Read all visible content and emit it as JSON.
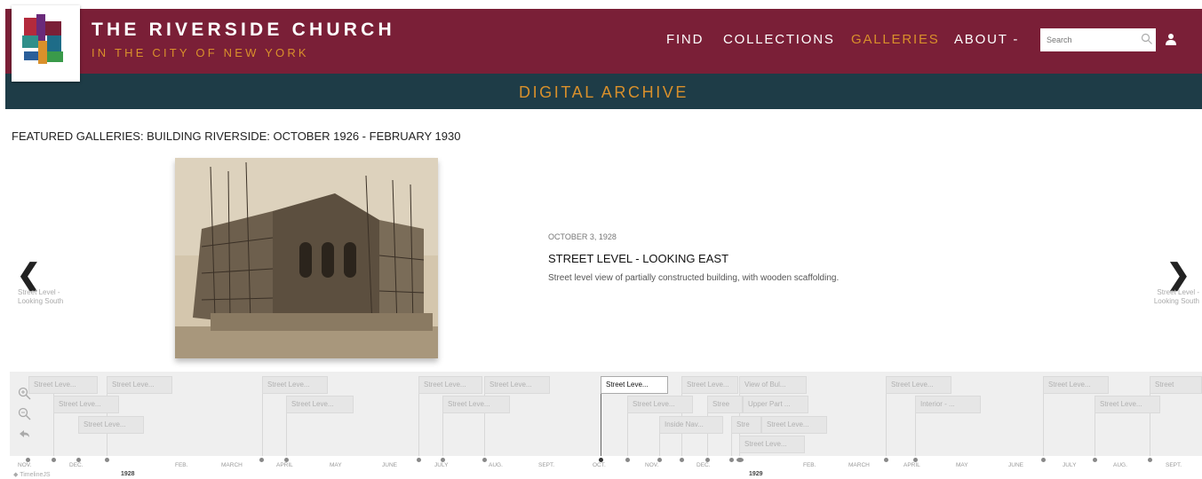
{
  "header": {
    "title": "THE RIVERSIDE CHURCH",
    "subtitle": "IN THE CITY OF NEW YORK",
    "nav": [
      {
        "label": "FIND",
        "active": false
      },
      {
        "label": "COLLECTIONS",
        "active": false
      },
      {
        "label": "GALLERIES",
        "active": true
      },
      {
        "label": "ABOUT -",
        "active": false
      }
    ],
    "search_placeholder": "Search"
  },
  "subbar": {
    "title": "DIGITAL ARCHIVE"
  },
  "page": {
    "heading": "FEATURED GALLERIES: BUILDING RIVERSIDE: OCTOBER 1926 - FEBRUARY 1930"
  },
  "slide": {
    "date": "OCTOBER 3, 1928",
    "title": "STREET LEVEL - LOOKING EAST",
    "description": "Street level view of partially constructed building, with wooden scaffolding.",
    "prev_label": "Street Level - Looking South",
    "next_label": "Street Level - Looking South"
  },
  "timeline": {
    "markers": [
      {
        "label": "Street Leve...",
        "active": false
      },
      {
        "label": "Street Leve...",
        "active": false
      },
      {
        "label": "Street Leve...",
        "active": false
      },
      {
        "label": "Street Leve...",
        "active": false
      },
      {
        "label": "Street Leve...",
        "active": false
      },
      {
        "label": "Street Leve...",
        "active": false
      },
      {
        "label": "Street Leve...",
        "active": false
      },
      {
        "label": "Street Leve...",
        "active": false
      },
      {
        "label": "Street Leve...",
        "active": false
      },
      {
        "label": "Street Leve...",
        "active": true
      },
      {
        "label": "Street Leve...",
        "active": false
      },
      {
        "label": "View of Bul...",
        "active": false
      },
      {
        "label": "Street Leve...",
        "active": false
      },
      {
        "label": "Stree",
        "active": false
      },
      {
        "label": "Upper Part ...",
        "active": false
      },
      {
        "label": "Inside Nav...",
        "active": false
      },
      {
        "label": "Stre",
        "active": false
      },
      {
        "label": "Street Leve...",
        "active": false
      },
      {
        "label": "Street Leve...",
        "active": false
      },
      {
        "label": "Street Leve...",
        "active": false
      },
      {
        "label": "Interior - ...",
        "active": false
      },
      {
        "label": "Street Leve...",
        "active": false
      },
      {
        "label": "Street Leve...",
        "active": false
      },
      {
        "label": "Street",
        "active": false
      },
      {
        "label": "Street Leve...",
        "active": false
      },
      {
        "label": "Street Leve...",
        "active": false
      }
    ],
    "months": [
      "NOV.",
      "DEC.",
      "FEB.",
      "MARCH",
      "APRIL",
      "MAY",
      "JUNE",
      "JULY",
      "AUG.",
      "SEPT.",
      "OCT.",
      "NOV.",
      "DEC.",
      "FEB.",
      "MARCH",
      "APRIL",
      "MAY",
      "JUNE",
      "JULY",
      "AUG.",
      "SEPT."
    ],
    "years": [
      "1928",
      "1929"
    ],
    "credit": "TimelineJS"
  }
}
